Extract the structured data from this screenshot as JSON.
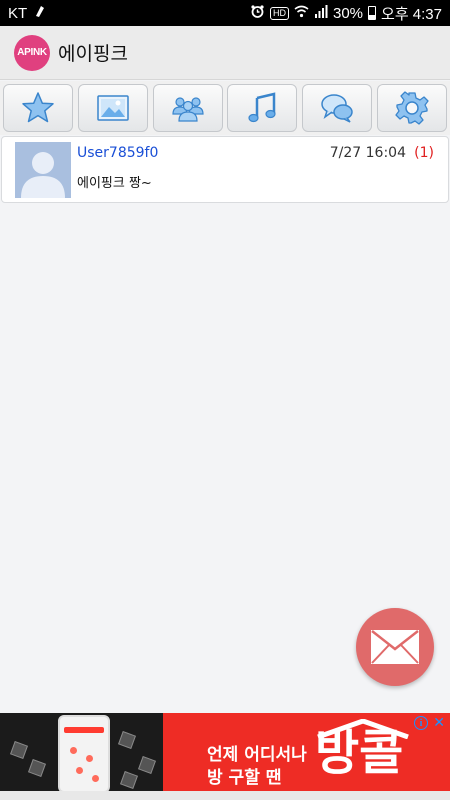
{
  "statusbar": {
    "carrier": "KT",
    "battery": "30%",
    "time": "오후 4:37",
    "hd_badge": "HD"
  },
  "app": {
    "logo_text": "APINK",
    "title": "에이핑크"
  },
  "toolbar": {
    "buttons": [
      {
        "name": "favorites",
        "icon": "star-icon"
      },
      {
        "name": "gallery",
        "icon": "image-icon"
      },
      {
        "name": "members",
        "icon": "people-icon"
      },
      {
        "name": "music",
        "icon": "music-note-icon"
      },
      {
        "name": "chat",
        "icon": "chat-bubbles-icon"
      },
      {
        "name": "settings",
        "icon": "gear-icon"
      }
    ]
  },
  "messages": [
    {
      "user": "User7859f0",
      "time": "7/27 16:04",
      "count": "(1)",
      "text": "에이핑크 짱~"
    }
  ],
  "fab": {
    "icon": "envelope-icon"
  },
  "ad": {
    "line1": "언제 어디서나",
    "line2": "방 구할 땐",
    "brand": "방콜",
    "info": "i",
    "close": "✕"
  },
  "colors": {
    "accent_blue": "#1a4fd6",
    "fab_red": "#e06a6a",
    "ad_red": "#ee2c25",
    "logo_pink": "#e0407f"
  }
}
